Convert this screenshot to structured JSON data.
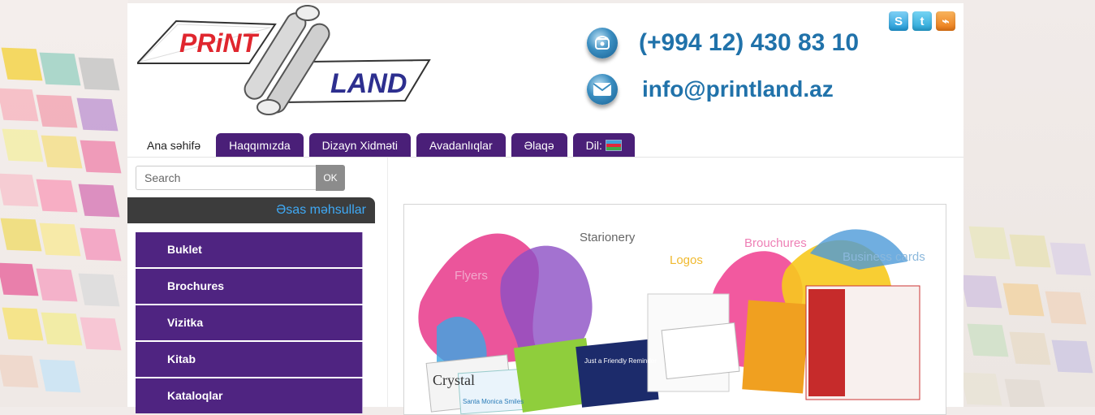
{
  "header": {
    "logo_text_1": "PRiNT",
    "logo_text_2": "LAND",
    "phone": "(+994 12) 430 83 10",
    "email": "info@printland.az"
  },
  "social": [
    {
      "icon": "skype-icon",
      "glyph": "S"
    },
    {
      "icon": "twitter-icon",
      "glyph": "t"
    },
    {
      "icon": "rss-icon",
      "glyph": "⌁"
    }
  ],
  "nav": {
    "home": "Ana səhifə",
    "about": "Haqqımızda",
    "design": "Dizayn Xidməti",
    "equipment": "Avadanlıqlar",
    "contact": "Əlaqə",
    "language": "Dil:"
  },
  "search": {
    "placeholder": "Search",
    "button": "OK"
  },
  "sidebar": {
    "heading": "Əsas məhsullar",
    "items": [
      {
        "label": "Buklet"
      },
      {
        "label": "Brochures"
      },
      {
        "label": "Vizitka"
      },
      {
        "label": "Kitab"
      },
      {
        "label": "Kataloqlar"
      }
    ]
  },
  "banner": {
    "labels": [
      "Starionery",
      "Logos",
      "Brouchures",
      "Business cards",
      "Flyers"
    ],
    "print_brand": "Crystal",
    "print_brand_2": "Santa Monica Smiles",
    "print_card_text": "Just a Friendly Reminder"
  },
  "colors": {
    "nav_tab": "#4a1f78",
    "sidebar_item": "#4f2481",
    "contact_text": "#2072aa",
    "sidebar_heading_text": "#3fa9f5"
  }
}
